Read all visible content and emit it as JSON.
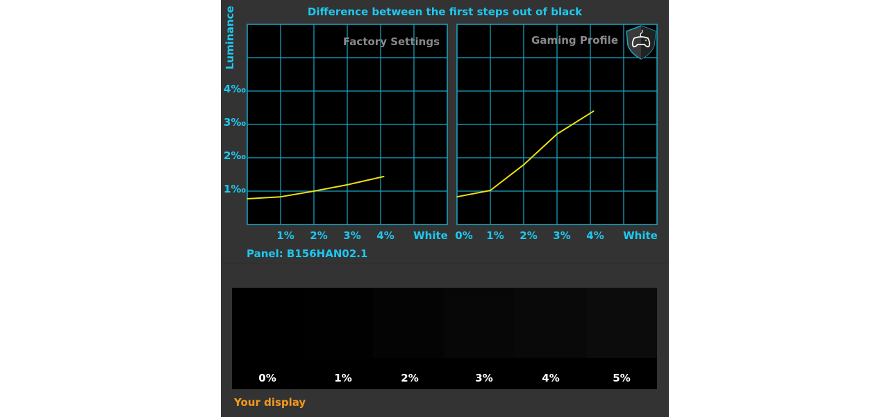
{
  "chart_data": [
    {
      "type": "line",
      "title": "Difference between the first steps out of black",
      "ylabel": "Luminance",
      "panel_label": "Factory Settings",
      "x_ticks": [
        "1%",
        "2%",
        "3%",
        "4%",
        "White"
      ],
      "y_ticks": [
        "1‰",
        "2‰",
        "3‰",
        "4‰"
      ],
      "xlim": [
        0,
        6
      ],
      "ylim": [
        0,
        6
      ],
      "grid": true,
      "line_color": "#f0e010",
      "x": [
        0,
        1,
        2,
        3,
        4.1
      ],
      "y": [
        0.77,
        0.83,
        1.0,
        1.19,
        1.44
      ]
    },
    {
      "type": "line",
      "panel_label": "Gaming Profile",
      "x_ticks": [
        "0%",
        "1%",
        "2%",
        "3%",
        "4%",
        "White"
      ],
      "xlim": [
        0,
        6
      ],
      "ylim": [
        0,
        6
      ],
      "grid": true,
      "line_color": "#f0e010",
      "icon": "gamepad-shield-icon",
      "x": [
        0,
        1,
        2,
        3,
        4.1
      ],
      "y": [
        0.83,
        1.02,
        1.79,
        2.71,
        3.4
      ]
    }
  ],
  "panel": "Panel: B156HAN02.1",
  "swatches": {
    "labels": [
      "0%",
      "1%",
      "2%",
      "3%",
      "4%",
      "5%"
    ],
    "colors": [
      "#000000",
      "#010101",
      "#040404",
      "#070707",
      "#090909",
      "#0c0c0c"
    ]
  },
  "your_display": "Your display",
  "colors": {
    "accent": "#1ec8f0",
    "grid": "#1aa8c8",
    "background": "#333333",
    "orange": "#f39a1e"
  }
}
